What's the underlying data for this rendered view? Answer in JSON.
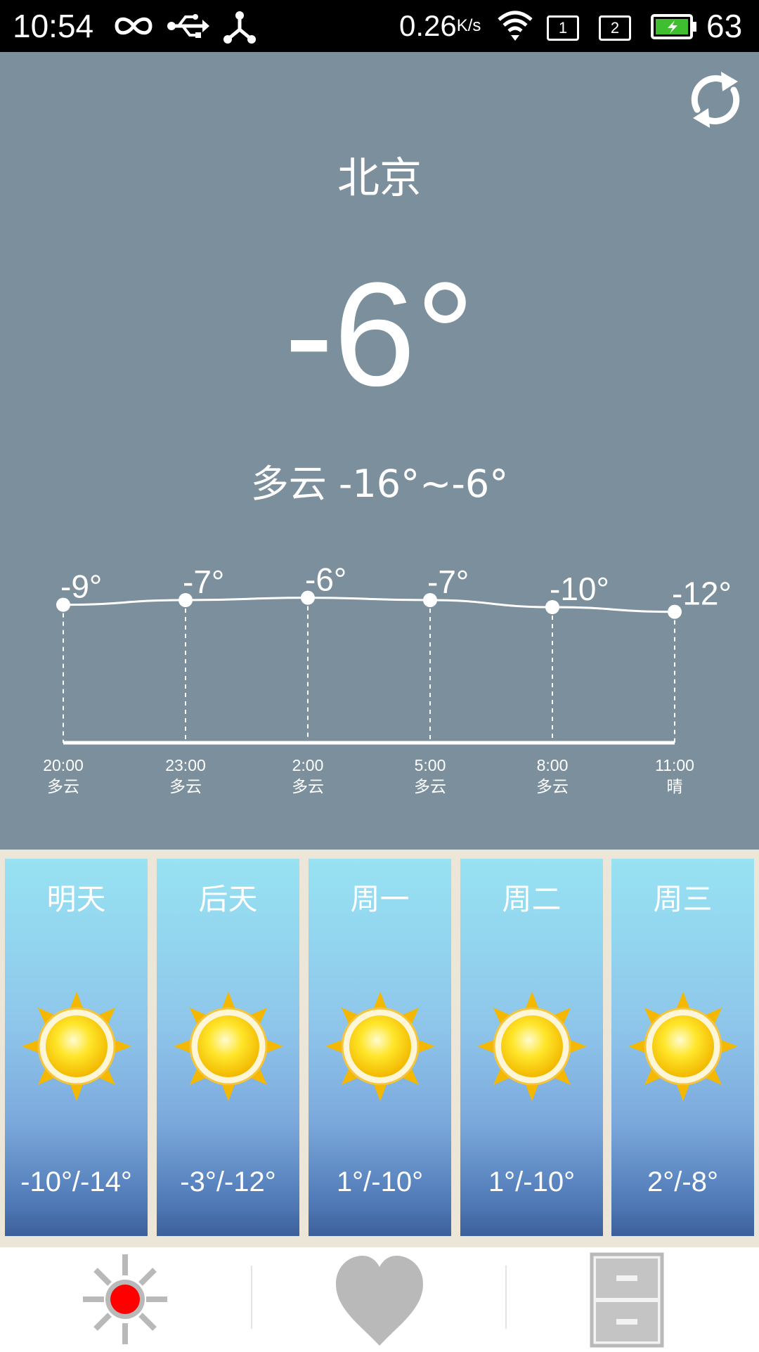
{
  "status_bar": {
    "time": "10:54",
    "net_speed": "0.26",
    "net_unit": "K/s",
    "sim1": "1",
    "sim2": "2",
    "battery_level": "63",
    "icons": [
      "infinity-icon",
      "usb-icon",
      "tethering-icon",
      "wifi-icon",
      "sim-icon",
      "sim-icon",
      "battery-icon"
    ]
  },
  "weather": {
    "city": "北京",
    "current_temp": "-6°",
    "summary": "多云 -16°~-6°",
    "refresh_icon": "refresh-icon"
  },
  "hourly": {
    "items": [
      {
        "temp": "-9°",
        "time": "20:00",
        "cond": "多云"
      },
      {
        "temp": "-7°",
        "time": "23:00",
        "cond": "多云"
      },
      {
        "temp": "-6°",
        "time": "2:00",
        "cond": "多云"
      },
      {
        "temp": "-7°",
        "time": "5:00",
        "cond": "多云"
      },
      {
        "temp": "-10°",
        "time": "8:00",
        "cond": "多云"
      },
      {
        "temp": "-12°",
        "time": "11:00",
        "cond": "晴"
      }
    ]
  },
  "chart_data": {
    "type": "line",
    "x": [
      "20:00",
      "23:00",
      "2:00",
      "5:00",
      "8:00",
      "11:00"
    ],
    "series": [
      {
        "values": [
          -9,
          -7,
          -6,
          -7,
          -10,
          -12
        ]
      }
    ],
    "ylim": [
      -16,
      -4
    ],
    "grid": false
  },
  "forecast": {
    "days": [
      {
        "day": "明天",
        "temp": "-10°/-14°",
        "icon": "sun-icon"
      },
      {
        "day": "后天",
        "temp": "-3°/-12°",
        "icon": "sun-icon"
      },
      {
        "day": "周一",
        "temp": "1°/-10°",
        "icon": "sun-icon"
      },
      {
        "day": "周二",
        "temp": "1°/-10°",
        "icon": "sun-icon"
      },
      {
        "day": "周三",
        "temp": "2°/-8°",
        "icon": "sun-icon"
      }
    ]
  },
  "nav": {
    "items": [
      {
        "icon": "weather-sun-icon",
        "active": true
      },
      {
        "icon": "heart-icon",
        "active": false
      },
      {
        "icon": "cabinet-icon",
        "active": false
      }
    ],
    "active_color": "#ff0000",
    "inactive_color": "#b9b9b9"
  },
  "colors": {
    "panel_bg": "#7c8f9c",
    "card_top": "#98e2f2",
    "card_bottom": "#3d5f9a",
    "battery": "#3fbf2f"
  }
}
